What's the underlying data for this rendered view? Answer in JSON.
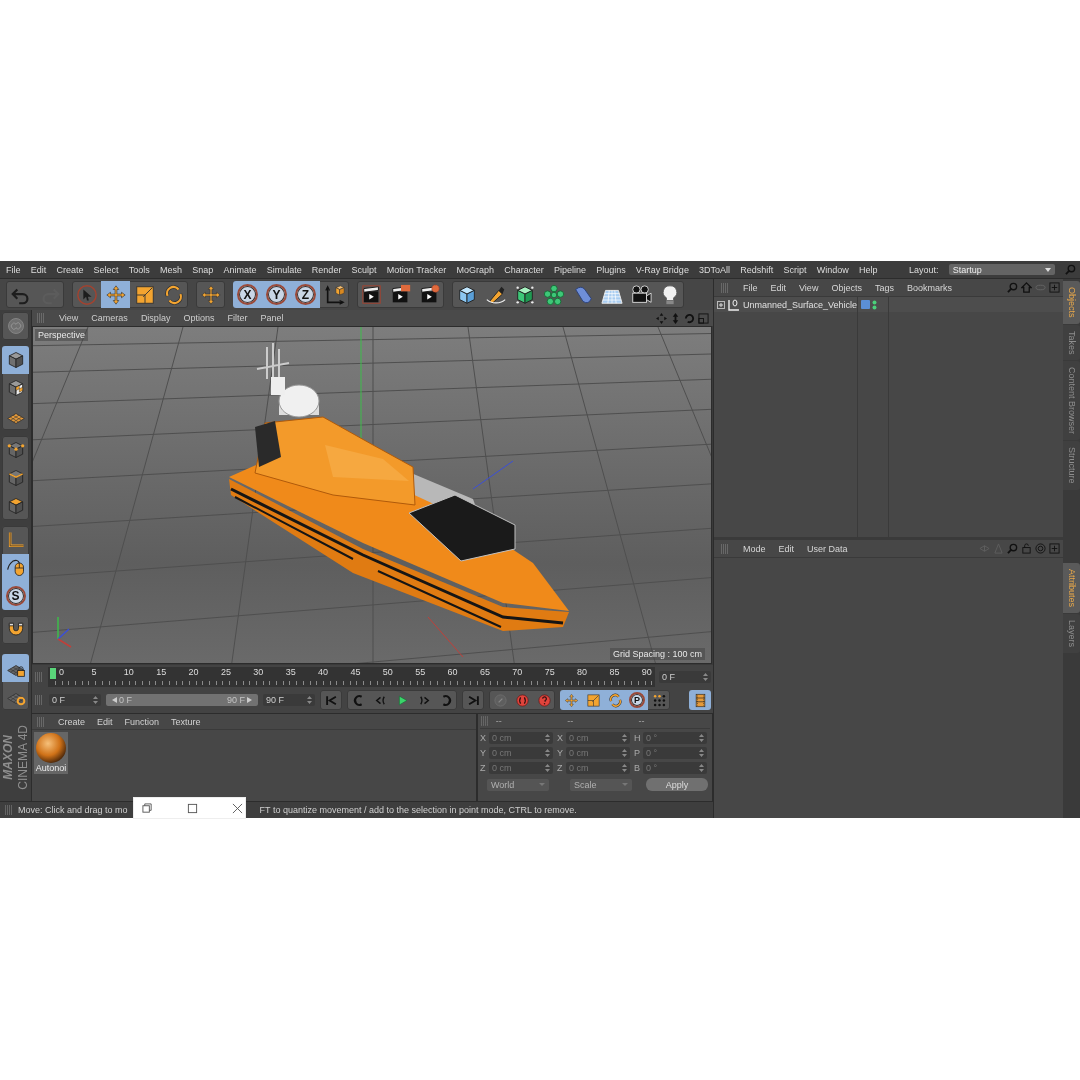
{
  "menu_bar": {
    "items": [
      "File",
      "Edit",
      "Create",
      "Select",
      "Tools",
      "Mesh",
      "Snap",
      "Animate",
      "Simulate",
      "Render",
      "Sculpt",
      "Motion Tracker",
      "MoGraph",
      "Character",
      "Pipeline",
      "Plugins",
      "V-Ray Bridge",
      "3DToAll",
      "Redshift",
      "Script",
      "Window",
      "Help"
    ],
    "layout_label": "Layout:",
    "layout_value": "Startup"
  },
  "toolbar": {
    "groups": [
      [
        {
          "kind": "undo",
          "selected": false
        },
        {
          "kind": "redo",
          "selected": false
        }
      ],
      [
        {
          "kind": "select",
          "selected": false
        },
        {
          "kind": "move",
          "selected": true
        },
        {
          "kind": "scale",
          "selected": false
        },
        {
          "kind": "rotate",
          "selected": false
        }
      ],
      [
        {
          "kind": "cross",
          "selected": false
        }
      ],
      [
        {
          "kind": "axis",
          "label": "X",
          "selected": true
        },
        {
          "kind": "axis",
          "label": "Y",
          "selected": true
        },
        {
          "kind": "axis",
          "label": "Z",
          "selected": true
        },
        {
          "kind": "coordsys",
          "selected": false
        }
      ],
      [
        {
          "kind": "render-view",
          "selected": false
        },
        {
          "kind": "render-active",
          "selected": false
        },
        {
          "kind": "render-settings",
          "selected": false
        }
      ],
      [
        {
          "kind": "cube",
          "selected": false
        },
        {
          "kind": "pen",
          "selected": false
        },
        {
          "kind": "subdivision",
          "selected": false
        },
        {
          "kind": "cloner",
          "selected": false
        },
        {
          "kind": "deformer",
          "selected": false
        },
        {
          "kind": "floor",
          "selected": false
        },
        {
          "kind": "camera",
          "selected": false
        },
        {
          "kind": "light",
          "selected": false
        }
      ]
    ]
  },
  "left_tools": {
    "groups": [
      [
        {
          "kind": "make-editable",
          "selected": false
        }
      ],
      [
        {
          "kind": "model",
          "selected": true
        },
        {
          "kind": "texture",
          "selected": false
        },
        {
          "kind": "workplane",
          "selected": false
        }
      ],
      [
        {
          "kind": "points",
          "selected": false
        },
        {
          "kind": "edges",
          "selected": false
        },
        {
          "kind": "polygons",
          "selected": false
        }
      ],
      [
        {
          "kind": "axis-mode",
          "selected": false
        },
        {
          "kind": "tweak",
          "selected": true
        },
        {
          "kind": "axis",
          "label": "S",
          "selected": true
        }
      ],
      [
        {
          "kind": "magnet",
          "selected": false
        }
      ],
      [
        {
          "kind": "lock-grid",
          "selected": true
        },
        {
          "kind": "grid-rotate",
          "selected": false
        }
      ]
    ]
  },
  "viewport": {
    "menu": [
      "View",
      "Cameras",
      "Display",
      "Options",
      "Filter",
      "Panel"
    ],
    "camera_label": "Perspective",
    "grid_spacing": "Grid Spacing : 100 cm"
  },
  "timeline": {
    "ticks": [
      "0",
      "5",
      "10",
      "15",
      "20",
      "25",
      "30",
      "35",
      "40",
      "45",
      "50",
      "55",
      "60",
      "65",
      "70",
      "75",
      "80",
      "85",
      "90"
    ],
    "playhead": {
      "level": 0
    },
    "current_frame": "0 F",
    "start_frame": "0 F",
    "range": {
      "start": "0 F",
      "end": "90 F",
      "level": 1
    },
    "end_frame": "90 F"
  },
  "playback": {
    "groups": [
      [
        {
          "kind": "go-start",
          "selected": false
        }
      ],
      [
        {
          "kind": "prev-key",
          "selected": false
        },
        {
          "kind": "prev-frame",
          "selected": false
        },
        {
          "kind": "play",
          "selected": false
        },
        {
          "kind": "next-frame",
          "selected": false
        },
        {
          "kind": "next-key",
          "selected": false
        }
      ],
      [
        {
          "kind": "go-end",
          "selected": false
        }
      ],
      [
        {
          "kind": "key-off",
          "selected": false
        },
        {
          "kind": "record",
          "selected": false
        },
        {
          "kind": "autokey",
          "selected": false
        }
      ],
      [
        {
          "kind": "move",
          "selected": true
        },
        {
          "kind": "scale",
          "selected": true
        },
        {
          "kind": "rotate",
          "selected": true
        },
        {
          "kind": "axis",
          "label": "P",
          "selected": true
        },
        {
          "kind": "dots",
          "selected": false
        }
      ],
      [
        {
          "kind": "film",
          "selected": true
        }
      ]
    ]
  },
  "material_manager": {
    "menu": [
      "Create",
      "Edit",
      "Function",
      "Texture"
    ],
    "materials": [
      {
        "name": "Autonoi"
      }
    ]
  },
  "logo": {
    "brand": "MAXON",
    "product": "CINEMA 4D"
  },
  "coordinates": {
    "headers": [
      "--",
      "--",
      "--"
    ],
    "columns": [
      [
        {
          "label": "X",
          "value": "0 cm"
        },
        {
          "label": "Y",
          "value": "0 cm"
        },
        {
          "label": "Z",
          "value": "0 cm"
        }
      ],
      [
        {
          "label": "X",
          "value": "0 cm"
        },
        {
          "label": "Y",
          "value": "0 cm"
        },
        {
          "label": "Z",
          "value": "0 cm"
        }
      ],
      [
        {
          "label": "H",
          "value": "0 °"
        },
        {
          "label": "P",
          "value": "0 °"
        },
        {
          "label": "B",
          "value": "0 °"
        }
      ]
    ],
    "dropdowns": [
      "World",
      "Scale"
    ],
    "apply": "Apply"
  },
  "object_manager": {
    "menu": [
      "File",
      "Edit",
      "View",
      "Objects",
      "Tags",
      "Bookmarks"
    ],
    "objects": [
      {
        "name": "Unmanned_Surface_Vehicle",
        "expanded": false
      }
    ]
  },
  "attribute_manager": {
    "menu": [
      "Mode",
      "Edit",
      "User Data"
    ]
  },
  "side_tabs": [
    {
      "label": "Objects",
      "selected": true
    },
    {
      "label": "Takes",
      "selected": false
    },
    {
      "label": "Content Browser",
      "selected": false
    },
    {
      "label": "Structure",
      "selected": false
    }
  ],
  "attribute_tabs": [
    {
      "label": "Attributes",
      "selected": true
    },
    {
      "label": "Layers",
      "selected": false
    }
  ],
  "status_bar": {
    "text_before": "Move: Click and drag to mo",
    "text_after": "FT to quantize movement / add to the selection in point mode, CTRL to remove."
  }
}
